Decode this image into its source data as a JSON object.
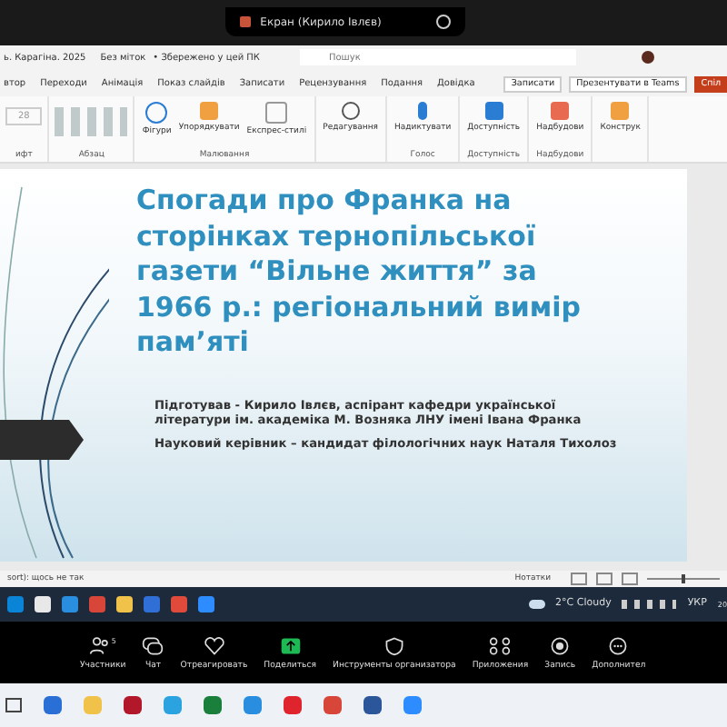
{
  "share_bar": {
    "title": "Екран (Кирило Івлєв)"
  },
  "title_bar": {
    "file": "ь. Карагіна. 2025",
    "sensitivity": "Без міток",
    "saved": "• Збережено у цей ПК",
    "search": {
      "placeholder": "Пошук"
    }
  },
  "ribbon_tabs": [
    "втор",
    "Переходи",
    "Анімація",
    "Показ слайдів",
    "Записати",
    "Рецензування",
    "Подання",
    "Довідка"
  ],
  "ribbon_buttons": [
    {
      "label": "Записати",
      "kind": "record"
    },
    {
      "label": "Презентувати в Teams",
      "kind": "teams"
    },
    {
      "label": "Спіл",
      "kind": "share"
    }
  ],
  "ribbon_groups": [
    {
      "label": "ифт",
      "buttons": [
        {
          "label": "28",
          "kind": "size"
        }
      ]
    },
    {
      "label": "Абзац"
    },
    {
      "label": "Малювання",
      "buttons": [
        {
          "label": "Фігури",
          "kind": "shapes"
        },
        {
          "label": "Упорядкувати",
          "kind": "arrange"
        },
        {
          "label": "Експрес-стилі",
          "kind": "styles"
        }
      ]
    },
    {
      "buttons": [
        {
          "label": "Редагування",
          "kind": "search"
        }
      ]
    },
    {
      "label": "Голос",
      "buttons": [
        {
          "label": "Надиктувати",
          "kind": "mic"
        }
      ]
    },
    {
      "label": "Доступність",
      "buttons": [
        {
          "label": "Доступність",
          "kind": "access"
        }
      ]
    },
    {
      "label": "Надбудови",
      "buttons": [
        {
          "label": "Надбудови",
          "kind": "addins"
        }
      ]
    },
    {
      "buttons": [
        {
          "label": "Конструк",
          "kind": "designer"
        }
      ]
    }
  ],
  "slide": {
    "title": "Спогади про Франка на сторінках тернопільської газети “Вільне життя” за 1966 р.: регіональний вимір пам’яті",
    "paragraphs": [
      "Підготував  - Кирило Івлєв, аспірант кафедри української літератури ім. академіка М. Возняка ЛНУ імені Івана Франка",
      "Науковий керівник – кандидат філологічних наук Наталя Тихолоз"
    ]
  },
  "status_bar": {
    "text": "sort): щось не так",
    "notes": "Нотатки",
    "zoom": {
      "level": 0.5
    }
  },
  "remote_taskbar": {
    "weather": "2°C Cloudy",
    "language": "УКР",
    "clock": "20"
  },
  "meeting_toolbar": [
    {
      "label": "Участники",
      "kind": "people",
      "count": "5"
    },
    {
      "label": "Чат",
      "kind": "chat"
    },
    {
      "label": "Отреагировать",
      "kind": "heart"
    },
    {
      "label": "Поделиться",
      "kind": "share"
    },
    {
      "label": "Инструменты организатора",
      "kind": "shield"
    },
    {
      "label": "Приложения",
      "kind": "apps"
    },
    {
      "label": "Запись",
      "kind": "record"
    },
    {
      "label": "Дополнител",
      "kind": "more"
    }
  ]
}
